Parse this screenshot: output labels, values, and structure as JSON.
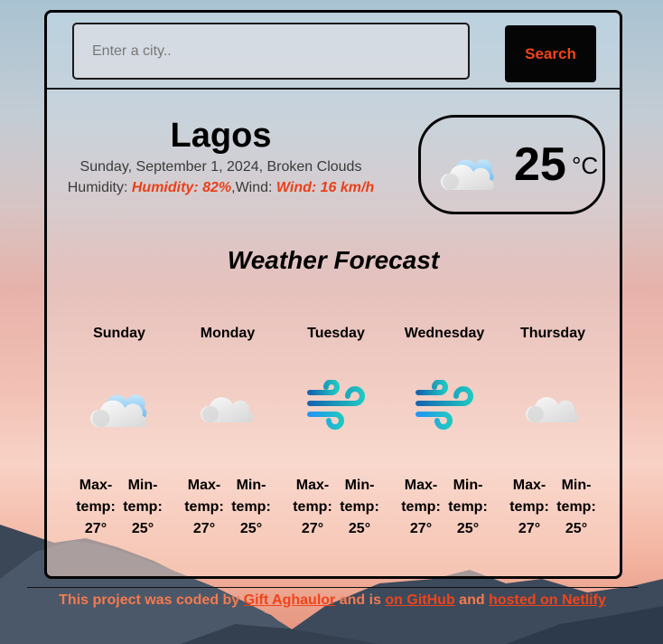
{
  "search": {
    "placeholder": "Enter a city..",
    "value": "",
    "button_label": "Search"
  },
  "current": {
    "city": "Lagos",
    "date_description": "Sunday, September 1, 2024, Broken Clouds",
    "humidity_label": "Humidity: ",
    "humidity_value": "Humidity: 82%",
    "wind_label": ",Wind: ",
    "wind_value": "Wind: 16 km/h",
    "icon": "cloud-sun-icon",
    "temperature": "25",
    "unit": "°C"
  },
  "forecast": {
    "title": "Weather Forecast",
    "days": [
      {
        "day": "Sunday",
        "icon": "cloud-blue-icon",
        "max_label": "Max-temp:",
        "min_label": "Min-temp:",
        "max": "27°",
        "min": "25°"
      },
      {
        "day": "Monday",
        "icon": "cloud-icon",
        "max_label": "Max-temp:",
        "min_label": "Min-temp:",
        "max": "27°",
        "min": "25°"
      },
      {
        "day": "Tuesday",
        "icon": "wind-icon",
        "max_label": "Max-temp:",
        "min_label": "Min-temp:",
        "max": "27°",
        "min": "25°"
      },
      {
        "day": "Wednesday",
        "icon": "wind-icon",
        "max_label": "Max-temp:",
        "min_label": "Min-temp:",
        "max": "27°",
        "min": "25°"
      },
      {
        "day": "Thursday",
        "icon": "cloud-icon",
        "max_label": "Max-temp:",
        "min_label": "Min-temp:",
        "max": "27°",
        "min": "25°"
      }
    ]
  },
  "footer": {
    "text_1": "This project was coded by ",
    "author_link": "Gift Aghaulor",
    "text_2": " and is ",
    "github_link": "on GitHub",
    "text_3": " and ",
    "netlify_link": "hosted on Netlify"
  },
  "colors": {
    "accent": "#f0441a",
    "button_bg": "#050505",
    "footer_text": "#f57a4e"
  }
}
